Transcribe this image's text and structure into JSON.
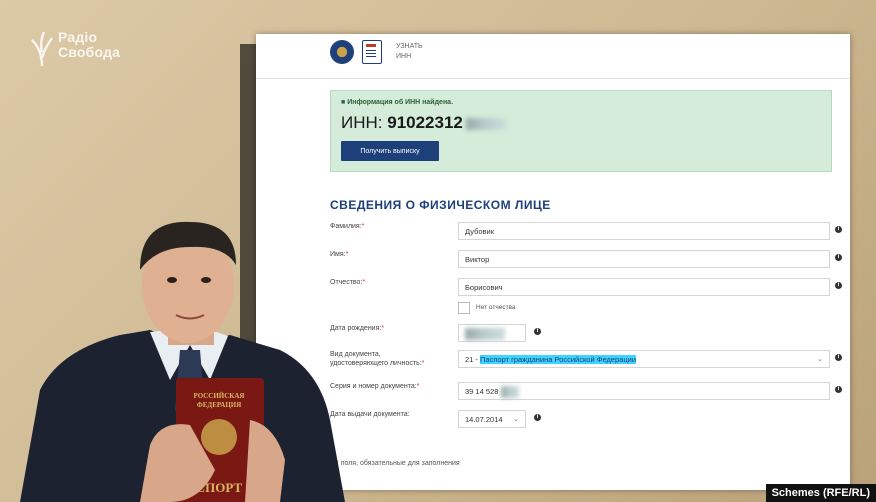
{
  "logo": {
    "line1": "Радіо",
    "line2": "Свобода"
  },
  "header": {
    "service_title": "УЗНАТЬ ИНН"
  },
  "info": {
    "found_text": "Информация об ИНН найдена.",
    "inn_label": "ИНН:",
    "inn_value": "91022312",
    "statement_button": "Получить выписку"
  },
  "section": {
    "title": "СВЕДЕНИЯ О ФИЗИЧЕСКОМ ЛИЦЕ"
  },
  "form": {
    "surname_label": "Фамилия:",
    "surname_value": "Дубовик",
    "name_label": "Имя:",
    "name_value": "Виктор",
    "patronymic_label": "Отчество:",
    "patronymic_value": "Борисович",
    "no_patronymic_label": "Нет отчества",
    "birthdate_label": "Дата рождения:",
    "doc_type_label_1": "Вид документа,",
    "doc_type_label_2": "удостоверяющего личность:",
    "doc_type_code": "21 -",
    "doc_type_value": "Паспорт гражданина Российской Федерации",
    "doc_number_label": "Серия и номер документа:",
    "doc_number_value": "39 14 528",
    "issue_date_label": "Дата выдачи документа:",
    "issue_date_value": "14.07.2014",
    "required_star": "*"
  },
  "footer": {
    "note": "поля, обязательные для заполнения"
  },
  "credit": "Schemes (RFE/RL)",
  "colors": {
    "brand": "#1d3f7a",
    "success_bg": "#d4ecd9",
    "highlight": "#3fd3ff",
    "required": "#c0392b"
  }
}
